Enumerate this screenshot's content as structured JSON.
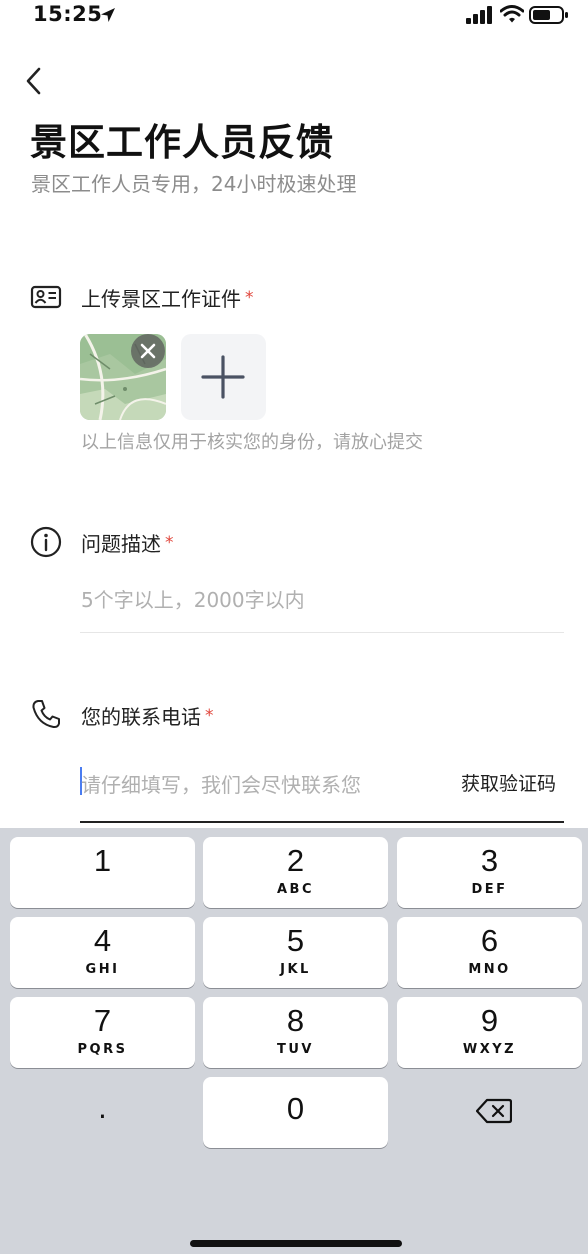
{
  "status_bar": {
    "time": "15:25",
    "icons": [
      "location-arrow-icon",
      "cellular-signal-icon",
      "wifi-icon",
      "battery-icon"
    ]
  },
  "header": {
    "back_icon": "chevron-left-icon",
    "title": "景区工作人员反馈",
    "subtitle": "景区工作人员专用，24小时极速处理"
  },
  "form": {
    "id_upload": {
      "icon": "id-card-icon",
      "label": "上传景区工作证件",
      "required_mark": "*",
      "thumbnail_icon": "map-thumbnail",
      "remove_icon": "close-icon",
      "add_icon": "plus-icon",
      "note": "以上信息仅用于核实您的身份，请放心提交"
    },
    "description": {
      "icon": "info-icon",
      "label": "问题描述",
      "required_mark": "*",
      "placeholder": "5个字以上，2000字以内"
    },
    "phone": {
      "icon": "phone-icon",
      "label": "您的联系电话",
      "required_mark": "*",
      "placeholder": "请仔细填写，我们会尽快联系您",
      "verify_button": "获取验证码"
    }
  },
  "keypad": {
    "keys": [
      {
        "num": "1",
        "letters": ""
      },
      {
        "num": "2",
        "letters": "ABC"
      },
      {
        "num": "3",
        "letters": "DEF"
      },
      {
        "num": "4",
        "letters": "GHI"
      },
      {
        "num": "5",
        "letters": "JKL"
      },
      {
        "num": "6",
        "letters": "MNO"
      },
      {
        "num": "7",
        "letters": "PQRS"
      },
      {
        "num": "8",
        "letters": "TUV"
      },
      {
        "num": "9",
        "letters": "WXYZ"
      }
    ],
    "dot": ".",
    "zero": "0",
    "delete_icon": "backspace-icon",
    "colors": {
      "background": "#d1d4da",
      "key": "#ffffff"
    }
  },
  "colors": {
    "required": "#e0463c",
    "placeholder": "#b0b0b0",
    "caret": "#4a7cf0"
  }
}
